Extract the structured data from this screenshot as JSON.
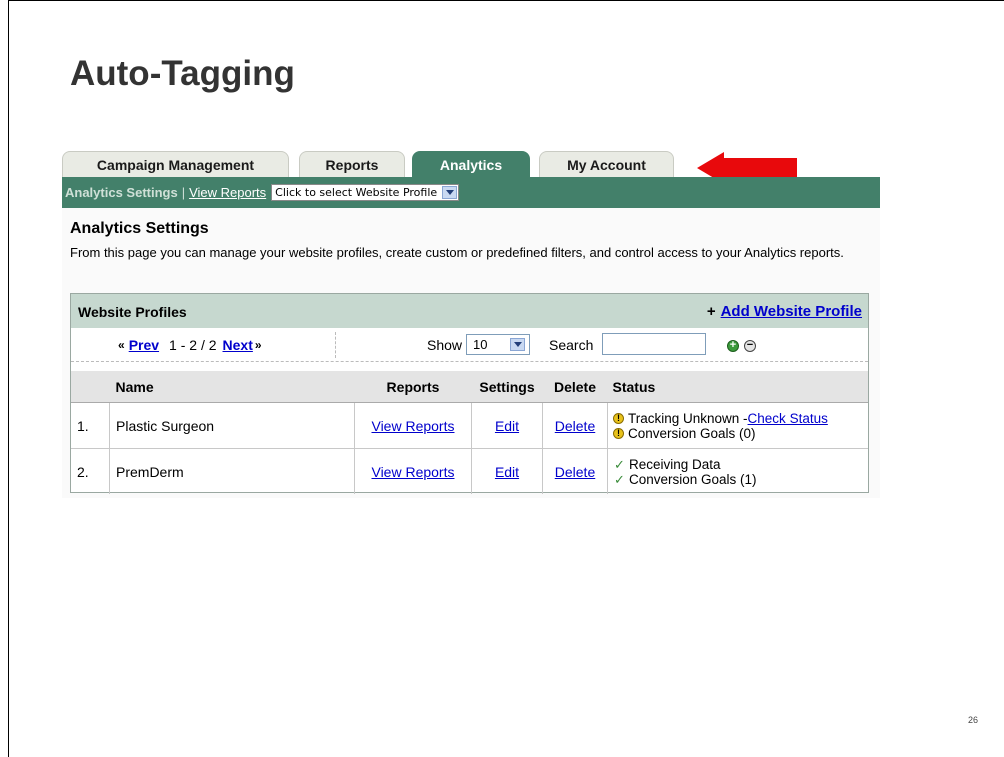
{
  "slide": {
    "title": "Auto-Tagging",
    "page_number": "26"
  },
  "tabs": [
    {
      "label": "Campaign Management",
      "active": false
    },
    {
      "label": "Reports",
      "active": false
    },
    {
      "label": "Analytics",
      "active": true
    },
    {
      "label": "My Account",
      "active": false
    }
  ],
  "subnav": {
    "current": "Analytics Settings",
    "separator": "|",
    "view_reports": "View Reports",
    "profile_select": "Click to select Website Profile"
  },
  "section": {
    "heading": "Analytics Settings",
    "intro": "From this page you can manage your website profiles, create custom or predefined filters, and control access to your Analytics reports."
  },
  "panel": {
    "title": "Website Profiles",
    "add_symbol": "+",
    "add_label": "Add Website Profile"
  },
  "pager": {
    "prev_chevron": "«",
    "prev": "Prev",
    "range": "1 - 2 / 2",
    "next": "Next",
    "next_chevron": "»",
    "show_label": "Show",
    "show_value": "10",
    "search_label": "Search",
    "search_value": ""
  },
  "table": {
    "headers": [
      "",
      "Name",
      "Reports",
      "Settings",
      "Delete",
      "Status"
    ],
    "rows": [
      {
        "num": "1.",
        "name": "Plastic Surgeon",
        "reports": "View Reports",
        "settings": "Edit",
        "delete": "Delete",
        "status": [
          {
            "icon": "warning-icon",
            "text": "Tracking Unknown - ",
            "link": "Check Status"
          },
          {
            "icon": "warning-icon",
            "text": "Conversion Goals (0)",
            "link": ""
          }
        ]
      },
      {
        "num": "2.",
        "name": "PremDerm",
        "reports": "View Reports",
        "settings": "Edit",
        "delete": "Delete",
        "status": [
          {
            "icon": "check-icon",
            "text": "Receiving Data",
            "link": ""
          },
          {
            "icon": "check-icon",
            "text": "Conversion Goals (1)",
            "link": ""
          }
        ]
      }
    ]
  },
  "colors": {
    "nav_green": "#43806a",
    "panel_header": "#c6d8cf",
    "link_blue": "#0000cc",
    "arrow_red": "#e8090c"
  }
}
